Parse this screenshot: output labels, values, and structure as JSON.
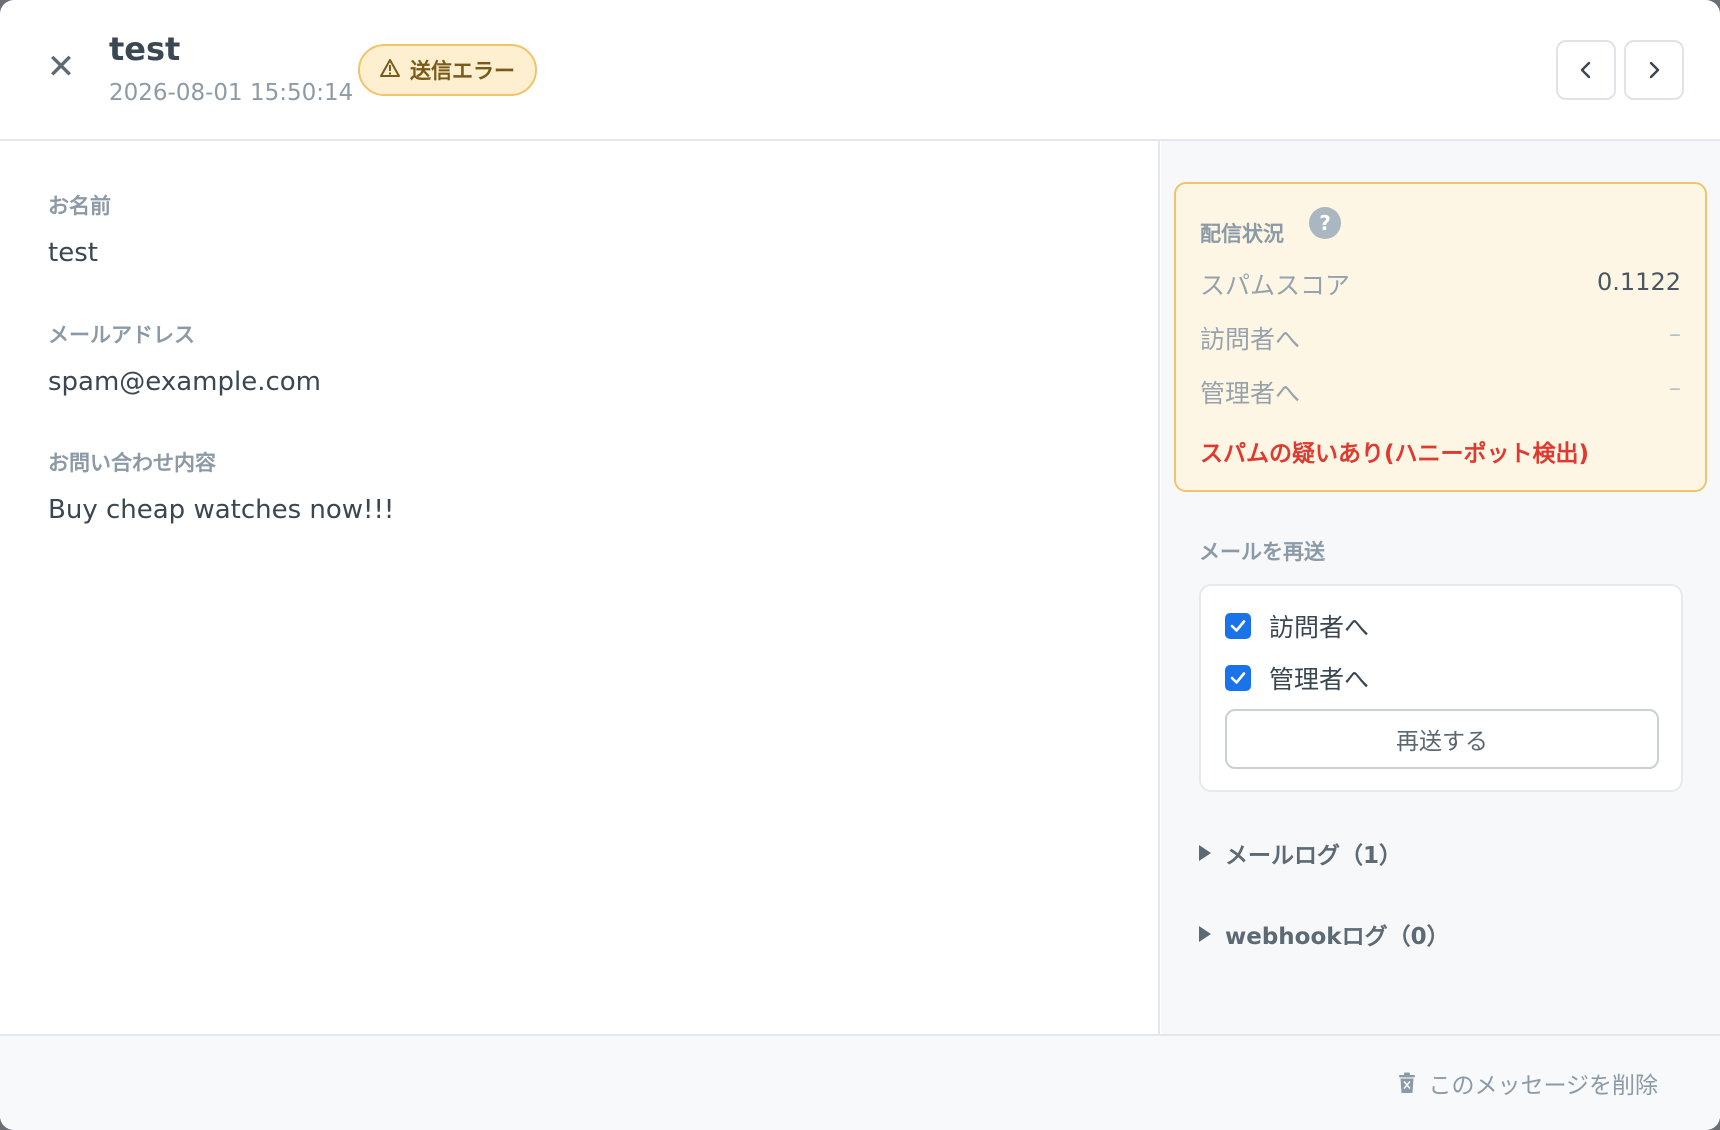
{
  "header": {
    "title": "test",
    "timestamp": "2026-08-01 15:50:14",
    "status_badge": "送信エラー",
    "status_icon": "warning-icon",
    "colors": {
      "badge_bg": "#fdefd0",
      "badge_border": "#efc46b",
      "badge_text": "#7a5a1a"
    }
  },
  "fields": [
    {
      "label": "お名前",
      "value": "test"
    },
    {
      "label": "メールアドレス",
      "value": "spam@example.com"
    },
    {
      "label": "お問い合わせ内容",
      "value": "Buy cheap watches now!!!"
    }
  ],
  "delivery": {
    "title": "配信状況",
    "help": "?",
    "spam_score_label": "スパムスコア",
    "spam_score_value": "0.1122",
    "visitor_label": "訪問者へ",
    "visitor_value": "–",
    "admin_label": "管理者へ",
    "admin_value": "–",
    "warning": "スパムの疑いあり(ハニーポット検出)",
    "warning_color": "#e0392f"
  },
  "resend": {
    "title": "メールを再送",
    "visitor_label": "訪問者へ",
    "visitor_checked": true,
    "admin_label": "管理者へ",
    "admin_checked": true,
    "button_label": "再送する"
  },
  "logs": {
    "mail_log": "メールログ（1）",
    "webhook_log": "webhookログ（0）"
  },
  "footer": {
    "delete_label": "このメッセージを削除",
    "delete_icon": "trash-icon"
  }
}
